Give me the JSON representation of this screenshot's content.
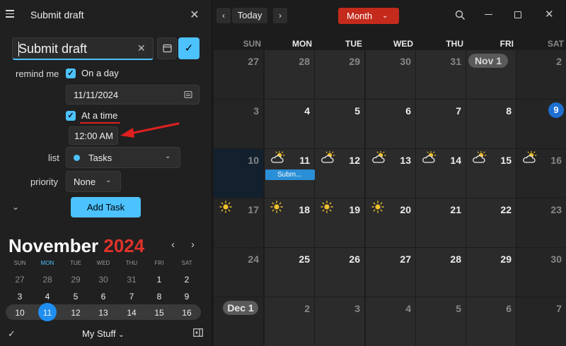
{
  "pane": {
    "title": "Submit draft",
    "task_title_value": "Submit draft",
    "remind_label": "remind me",
    "on_a_day_label": "On a day",
    "date_value": "11/11/2024",
    "at_a_time_label": "At a time",
    "time_value": "12:00 AM",
    "list_label": "list",
    "list_value": "Tasks",
    "priority_label": "priority",
    "priority_value": "None",
    "add_task_label": "Add Task"
  },
  "mini_calendar": {
    "month": "November",
    "year": "2024",
    "weekdays": [
      "SUN",
      "MON",
      "TUE",
      "WED",
      "THU",
      "FRI",
      "SAT"
    ],
    "weeks": [
      [
        "27",
        "28",
        "29",
        "30",
        "31",
        "1",
        "2"
      ],
      [
        "3",
        "4",
        "5",
        "6",
        "7",
        "8",
        "9"
      ],
      [
        "10",
        "11",
        "12",
        "13",
        "14",
        "15",
        "16"
      ]
    ],
    "footer_list": "My Stuff"
  },
  "calendar": {
    "today_label": "Today",
    "view_label": "Month",
    "weekdays": [
      "SUN",
      "MON",
      "TUE",
      "WED",
      "THU",
      "FRI",
      "SAT"
    ],
    "weeks": [
      [
        "27",
        "28",
        "29",
        "30",
        "31",
        "Nov 1",
        "2"
      ],
      [
        "3",
        "4",
        "5",
        "6",
        "7",
        "8",
        "9"
      ],
      [
        "10",
        "11",
        "12",
        "13",
        "14",
        "15",
        "16"
      ],
      [
        "17",
        "18",
        "19",
        "20",
        "21",
        "22",
        "23"
      ],
      [
        "24",
        "25",
        "26",
        "27",
        "28",
        "29",
        "30"
      ],
      [
        "Dec 1",
        "2",
        "3",
        "4",
        "5",
        "6",
        "7"
      ]
    ],
    "event_label": "Subm...",
    "accent_color": "#c42b1c",
    "event_color": "#2a8fd6"
  }
}
